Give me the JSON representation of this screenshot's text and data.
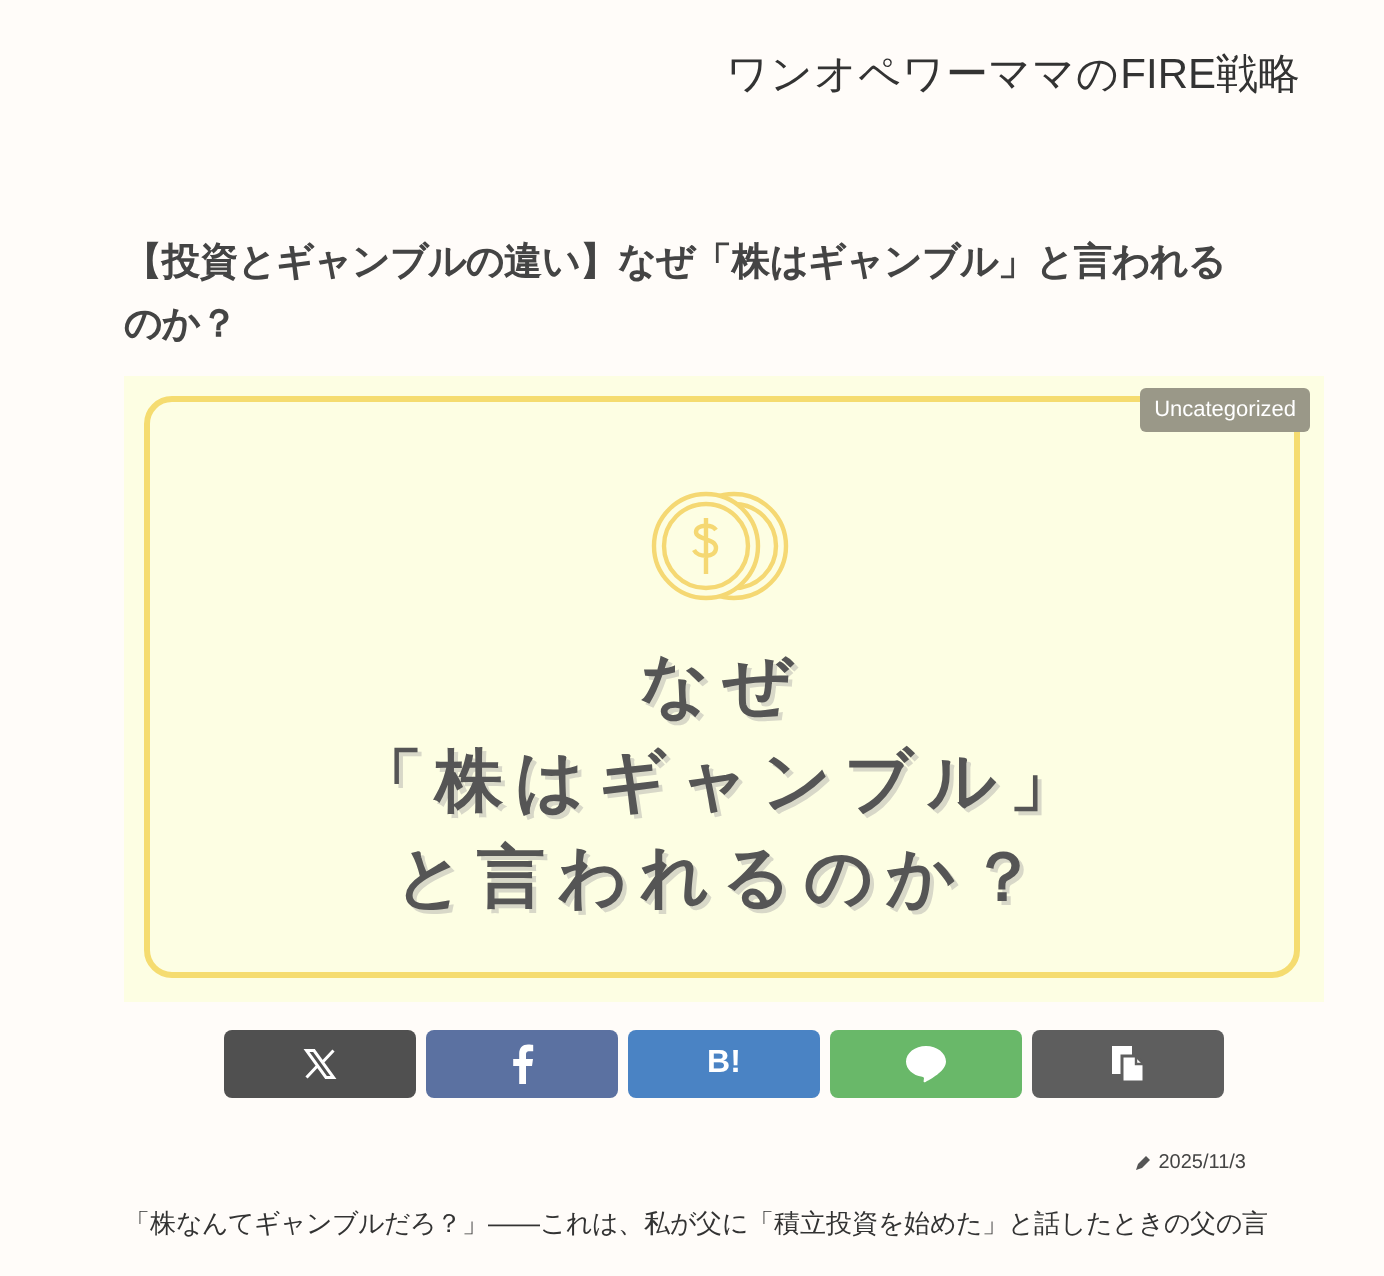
{
  "site_title": "ワンオペワーママのFIRE戦略",
  "article": {
    "title": "【投資とギャンブルの違い】なぜ「株はギャンブル」と言われるのか？",
    "eyecatch": {
      "category": "Uncategorized",
      "lines": [
        "なぜ",
        "「株はギャンブル」",
        "と言われるのか？"
      ]
    },
    "share_buttons": [
      {
        "kind": "x",
        "color": "#505050"
      },
      {
        "kind": "facebook",
        "color": "#5b71a1"
      },
      {
        "kind": "hatena",
        "color": "#4a83c4",
        "label": "B!"
      },
      {
        "kind": "line",
        "color": "#69b869"
      },
      {
        "kind": "copy",
        "color": "#5e5e5e"
      }
    ],
    "date": "2025/11/3",
    "body": "「株なんてギャンブルだろ？」――これは、私が父に「積立投資を始めた」と話したときの父の言"
  }
}
